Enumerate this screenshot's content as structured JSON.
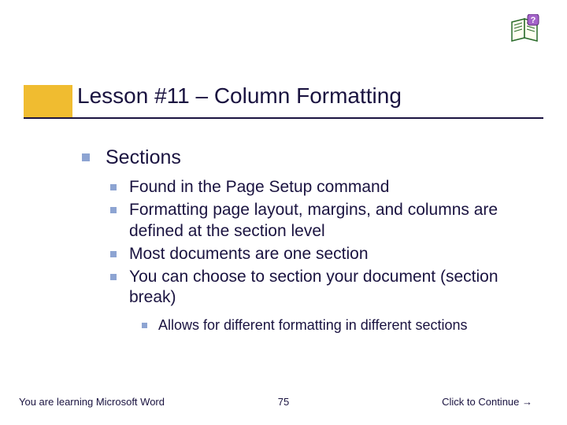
{
  "title": "Lesson #11 – Column Formatting",
  "section_heading": "Sections",
  "bullets": [
    "Found in the Page Setup command",
    "Formatting page layout, margins, and columns are defined at the section level",
    "Most documents are one section",
    "You can choose to section your document (section break)"
  ],
  "sub_bullet": "Allows for different formatting in different sections",
  "footer": {
    "left": "You are learning Microsoft Word",
    "page": "75",
    "right": "Click to Continue →"
  },
  "icon": "help-book-icon"
}
